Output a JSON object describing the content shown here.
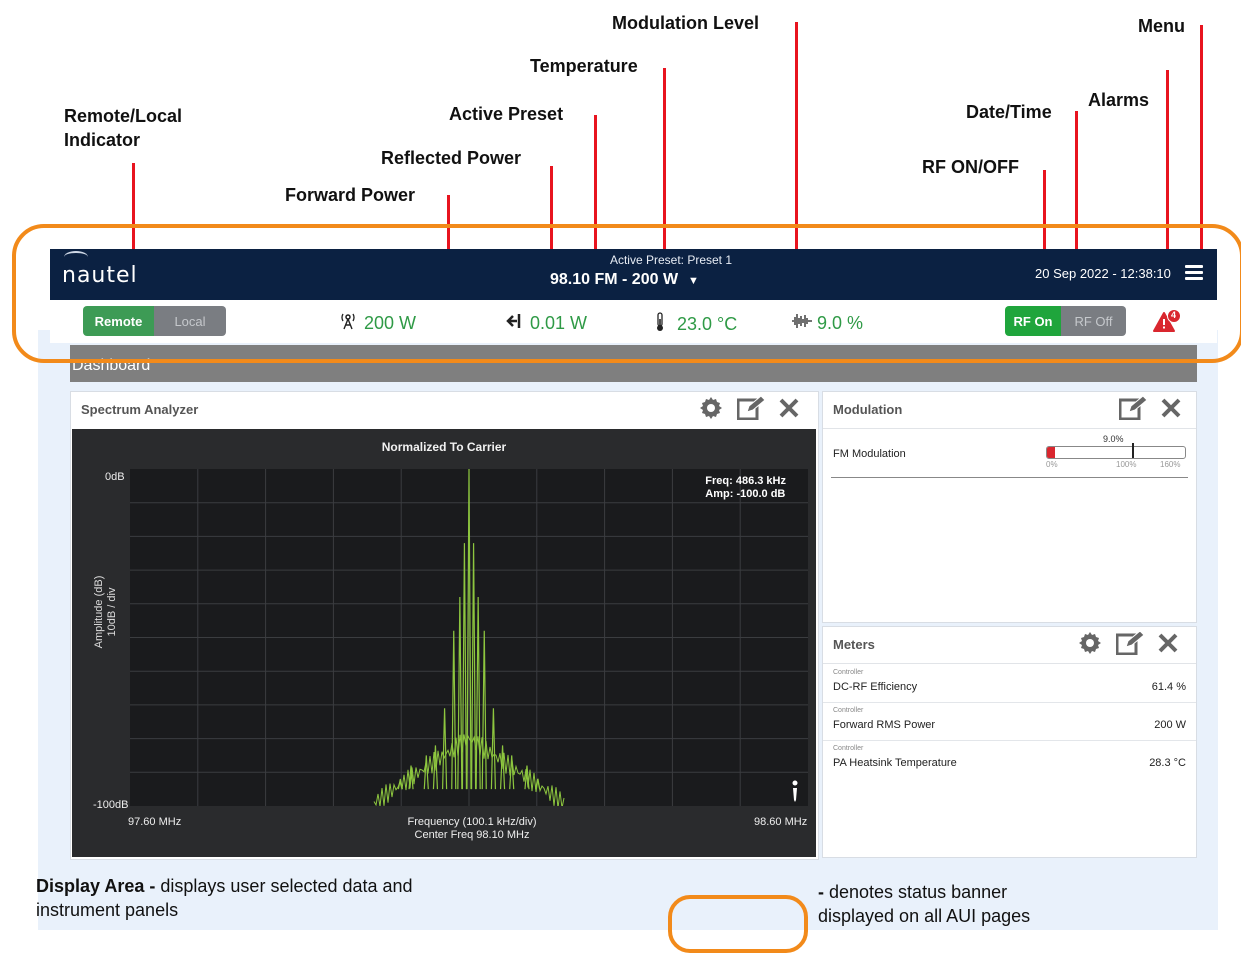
{
  "callouts": {
    "remote_local": "Remote/Local",
    "remote_local_2": "Indicator",
    "forward_power": "Forward Power",
    "reflected_power": "Reflected Power",
    "active_preset": "Active Preset",
    "temperature": "Temperature",
    "modulation_level": "Modulation Level",
    "rf_on_off": "RF ON/OFF",
    "date_time": "Date/Time",
    "alarms": "Alarms",
    "menu": "Menu"
  },
  "navbar": {
    "logo": "nautel",
    "preset_label": "Active Preset: Preset 1",
    "preset_value": "98.10 FM - 200 W",
    "datetime": "20 Sep 2022 - 12:38:10"
  },
  "status": {
    "remote_label": "Remote",
    "local_label": "Local",
    "forward_power": "200 W",
    "reflected_power": "0.01 W",
    "temperature": "23.0 °C",
    "modulation": "9.0 %",
    "rf_on_label": "RF On",
    "rf_off_label": "RF Off",
    "alarm_count": "4"
  },
  "dashboard": {
    "title": "Dashboard"
  },
  "spectrum": {
    "panel_title": "Spectrum Analyzer",
    "chart_title": "Normalized To Carrier",
    "readout_freq": "Freq: 486.3 kHz",
    "readout_amp": "Amp: -100.0 dB",
    "y_top": "0dB",
    "y_bottom": "-100dB",
    "y_label_1": "Amplitude (dB)",
    "y_label_2": "10dB / div",
    "x_left": "97.60 MHz",
    "x_right": "98.60 MHz",
    "x_center_1": "Frequency (100.1 kHz/div)",
    "x_center_2": "Center Freq 98.10 MHz"
  },
  "modulation": {
    "panel_title": "Modulation",
    "row_label": "FM Modulation",
    "value_label": "9.0%",
    "scale_0": "0%",
    "scale_100": "100%",
    "scale_160": "160%",
    "value_percent": 9.0
  },
  "meters": {
    "panel_title": "Meters",
    "items": [
      {
        "source": "Controller",
        "name": "DC-RF Efficiency",
        "value": "61.4 %"
      },
      {
        "source": "Controller",
        "name": "Forward RMS Power",
        "value": "200 W"
      },
      {
        "source": "Controller",
        "name": "PA Heatsink Temperature",
        "value": "28.3 °C"
      }
    ]
  },
  "footer": {
    "display_area_bold": "Display Area -",
    "display_area_text": " displays user selected data and",
    "display_area_text_2": "instrument panels",
    "banner_note_bold": "-",
    "banner_note_text": " denotes status banner",
    "banner_note_text_2": "displayed on all AUI pages"
  },
  "colors": {
    "annotation_outline": "#f28a1a",
    "leader_line": "#e8141f",
    "navbar": "#0b2142",
    "metric_green": "#2f9a46",
    "trace_green": "#8dc63f",
    "alarm_red": "#d9262e"
  }
}
